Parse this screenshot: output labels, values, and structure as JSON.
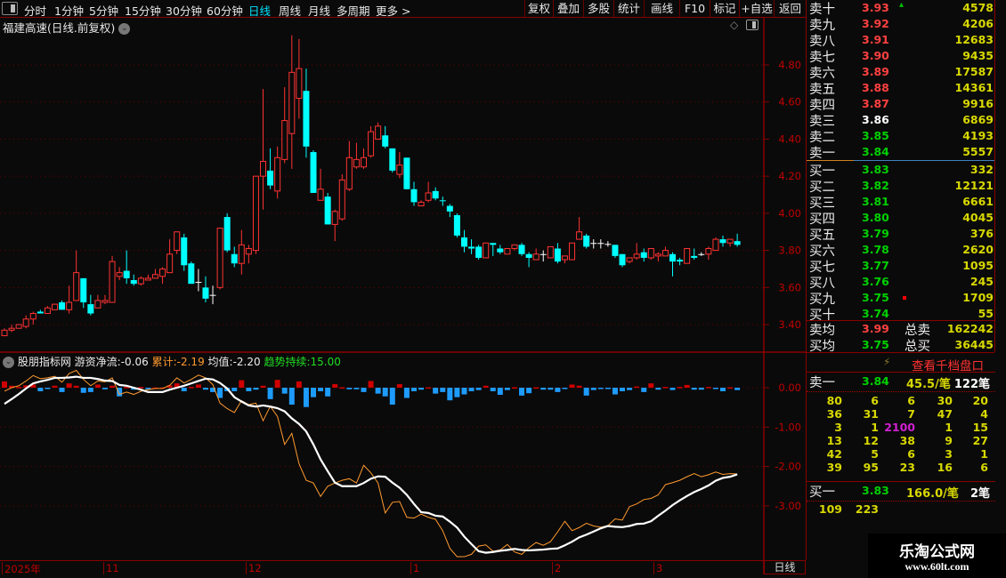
{
  "toolbar": {
    "tabs": [
      "分时",
      "1分钟",
      "5分钟",
      "15分钟",
      "30分钟",
      "60分钟",
      "日线",
      "周线",
      "月线",
      "多周期",
      "更多 >"
    ],
    "active_tab": "日线",
    "buttons": [
      "复权",
      "叠加",
      "多股",
      "统计",
      "画线",
      "F10",
      "标记",
      "+自选",
      "返回"
    ]
  },
  "stock": {
    "title": "福建高速(日线.前复权)"
  },
  "price_axis": [
    "4.80",
    "4.60",
    "4.40",
    "4.20",
    "4.00",
    "3.80",
    "3.60",
    "3.40"
  ],
  "indicator": {
    "name": "股朋指标网",
    "net_label": "游资净流:",
    "net_value": "-0.06",
    "cum_label": "累计:",
    "cum_value": "-2.19",
    "avg_label": "均值:",
    "avg_value": "-2.20",
    "trend_label": "趋势持续:",
    "trend_value": "15.00",
    "axis": [
      "0.00",
      "-1.00",
      "-2.00",
      "-3.00"
    ]
  },
  "date_axis": [
    "2025年",
    "11",
    "12",
    "1",
    "2",
    "3"
  ],
  "period": "日线",
  "colors": {
    "up": "#ff3232",
    "down": "#00ffff",
    "bg": "#0a0a0a",
    "grid": "#8b0000",
    "avg_line": "#ffffff",
    "cum_line": "#ff9a2e",
    "bar_up": "#d00000",
    "bar_down": "#1e9bff"
  },
  "order_book": {
    "asks": [
      {
        "label": "卖十",
        "price": "3.93",
        "vol": "4578",
        "mark": "up-triangle"
      },
      {
        "label": "卖九",
        "price": "3.92",
        "vol": "4206"
      },
      {
        "label": "卖八",
        "price": "3.91",
        "vol": "12683"
      },
      {
        "label": "卖七",
        "price": "3.90",
        "vol": "9435"
      },
      {
        "label": "卖六",
        "price": "3.89",
        "vol": "17587"
      },
      {
        "label": "卖五",
        "price": "3.88",
        "vol": "14361"
      },
      {
        "label": "卖四",
        "price": "3.87",
        "vol": "9916"
      },
      {
        "label": "卖三",
        "price": "3.86",
        "vol": "6869"
      },
      {
        "label": "卖二",
        "price": "3.85",
        "vol": "4193"
      },
      {
        "label": "卖一",
        "price": "3.84",
        "vol": "5557"
      }
    ],
    "bids": [
      {
        "label": "买一",
        "price": "3.83",
        "vol": "332"
      },
      {
        "label": "买二",
        "price": "3.82",
        "vol": "12121"
      },
      {
        "label": "买三",
        "price": "3.81",
        "vol": "6661"
      },
      {
        "label": "买四",
        "price": "3.80",
        "vol": "4045"
      },
      {
        "label": "买五",
        "price": "3.79",
        "vol": "376"
      },
      {
        "label": "买六",
        "price": "3.78",
        "vol": "2620"
      },
      {
        "label": "买七",
        "price": "3.77",
        "vol": "1095"
      },
      {
        "label": "买八",
        "price": "3.76",
        "vol": "245"
      },
      {
        "label": "买九",
        "price": "3.75",
        "vol": "1709",
        "mark": "red-square"
      },
      {
        "label": "买十",
        "price": "3.74",
        "vol": "55"
      }
    ],
    "avg_sell": {
      "label": "卖均",
      "price": "3.99",
      "total_label": "总卖",
      "total": "162242"
    },
    "avg_buy": {
      "label": "买均",
      "price": "3.75",
      "total_label": "总买",
      "total": "36445"
    }
  },
  "tick_panel": {
    "link": "查看千档盘口",
    "ask1": {
      "label": "卖一",
      "price": "3.84",
      "avg": "45.5/笔",
      "count": "122笔"
    },
    "ask_queue": [
      [
        "80",
        "6",
        "6",
        "30",
        "20"
      ],
      [
        "36",
        "31",
        "7",
        "47",
        "4"
      ],
      [
        "3",
        "1",
        "2100",
        "1",
        "15"
      ],
      [
        "13",
        "12",
        "38",
        "9",
        "27"
      ],
      [
        "42",
        "5",
        "6",
        "3",
        "1"
      ],
      [
        "39",
        "95",
        "23",
        "16",
        "6"
      ]
    ],
    "highlight": "2100",
    "bid1": {
      "label": "买一",
      "price": "3.83",
      "avg": "166.0/笔",
      "count": "2笔"
    },
    "bid_queue": [
      "109",
      "223"
    ]
  },
  "watermark": {
    "name": "乐淘公式网",
    "url": "www.60lt.com"
  },
  "chart_data": {
    "type": "candlestick",
    "ylim": [
      3.3,
      4.98
    ],
    "ohlc": [
      [
        3.34,
        3.38,
        3.34,
        3.37
      ],
      [
        3.37,
        3.4,
        3.36,
        3.38
      ],
      [
        3.38,
        3.4,
        3.38,
        3.4
      ],
      [
        3.39,
        3.45,
        3.38,
        3.43
      ],
      [
        3.43,
        3.47,
        3.4,
        3.46
      ],
      [
        3.47,
        3.48,
        3.46,
        3.46
      ],
      [
        3.46,
        3.5,
        3.46,
        3.49
      ],
      [
        3.48,
        3.51,
        3.48,
        3.51
      ],
      [
        3.52,
        3.53,
        3.48,
        3.48
      ],
      [
        3.48,
        3.61,
        3.46,
        3.52
      ],
      [
        3.53,
        3.8,
        3.53,
        3.68
      ],
      [
        3.65,
        3.65,
        3.49,
        3.52
      ],
      [
        3.51,
        3.56,
        3.45,
        3.46
      ],
      [
        3.49,
        3.56,
        3.49,
        3.53
      ],
      [
        3.52,
        3.56,
        3.51,
        3.53
      ],
      [
        3.52,
        3.77,
        3.52,
        3.74
      ],
      [
        3.66,
        3.71,
        3.64,
        3.68
      ],
      [
        3.69,
        3.8,
        3.62,
        3.65
      ],
      [
        3.64,
        3.67,
        3.61,
        3.62
      ],
      [
        3.62,
        3.66,
        3.61,
        3.65
      ],
      [
        3.64,
        3.67,
        3.64,
        3.65
      ],
      [
        3.65,
        3.7,
        3.65,
        3.67
      ],
      [
        3.66,
        3.71,
        3.62,
        3.7
      ],
      [
        3.68,
        3.86,
        3.68,
        3.78
      ],
      [
        3.8,
        3.9,
        3.78,
        3.9
      ],
      [
        3.87,
        3.89,
        3.69,
        3.72
      ],
      [
        3.73,
        3.74,
        3.62,
        3.62
      ],
      [
        3.63,
        3.7,
        3.58,
        3.63
      ],
      [
        3.6,
        3.66,
        3.52,
        3.54
      ],
      [
        3.56,
        3.61,
        3.51,
        3.56
      ],
      [
        3.6,
        3.92,
        3.59,
        3.92
      ],
      [
        3.98,
        4.0,
        3.79,
        3.8
      ],
      [
        3.78,
        3.82,
        3.71,
        3.73
      ],
      [
        3.73,
        3.91,
        3.67,
        3.83
      ],
      [
        3.78,
        3.83,
        3.73,
        3.81
      ],
      [
        3.8,
        4.2,
        3.78,
        4.2
      ],
      [
        4.2,
        4.67,
        4.02,
        4.28
      ],
      [
        4.23,
        4.35,
        4.13,
        4.15
      ],
      [
        4.12,
        4.36,
        4.08,
        4.3
      ],
      [
        4.29,
        4.68,
        4.27,
        4.5
      ],
      [
        4.43,
        4.96,
        4.24,
        4.76
      ],
      [
        4.62,
        4.94,
        4.51,
        4.78
      ],
      [
        4.66,
        4.78,
        4.3,
        4.36
      ],
      [
        4.33,
        4.34,
        4.11,
        4.11
      ],
      [
        4.07,
        4.24,
        4.07,
        4.13
      ],
      [
        4.09,
        4.11,
        3.94,
        3.94
      ],
      [
        3.94,
        4.02,
        3.85,
        4.01
      ],
      [
        3.97,
        4.21,
        3.96,
        4.18
      ],
      [
        4.13,
        4.39,
        4.12,
        4.3
      ],
      [
        4.25,
        4.38,
        4.24,
        4.29
      ],
      [
        4.25,
        4.35,
        4.24,
        4.3
      ],
      [
        4.31,
        4.47,
        4.3,
        4.44
      ],
      [
        4.4,
        4.49,
        4.4,
        4.47
      ],
      [
        4.42,
        4.47,
        4.35,
        4.36
      ],
      [
        4.35,
        4.35,
        4.22,
        4.23
      ],
      [
        4.21,
        4.33,
        4.19,
        4.26
      ],
      [
        4.3,
        4.3,
        4.13,
        4.13
      ],
      [
        4.13,
        4.17,
        4.04,
        4.06
      ],
      [
        4.04,
        4.07,
        4.04,
        4.06
      ],
      [
        4.07,
        4.17,
        4.06,
        4.11
      ],
      [
        4.12,
        4.14,
        4.07,
        4.08
      ],
      [
        4.07,
        4.09,
        4.04,
        4.065
      ],
      [
        4.04,
        4.05,
        3.98,
        4.01
      ],
      [
        3.99,
        4.0,
        3.87,
        3.88
      ],
      [
        3.87,
        3.91,
        3.79,
        3.82
      ],
      [
        3.82,
        3.86,
        3.78,
        3.81
      ],
      [
        3.82,
        3.83,
        3.75,
        3.76
      ],
      [
        3.76,
        3.84,
        3.76,
        3.84
      ],
      [
        3.84,
        3.84,
        3.77,
        3.83
      ],
      [
        3.81,
        3.83,
        3.78,
        3.79
      ],
      [
        3.78,
        3.81,
        3.78,
        3.81
      ],
      [
        3.81,
        3.83,
        3.8,
        3.83
      ],
      [
        3.83,
        3.84,
        3.77,
        3.78
      ],
      [
        3.78,
        3.79,
        3.71,
        3.76
      ],
      [
        3.75,
        3.81,
        3.75,
        3.78
      ],
      [
        3.78,
        3.8,
        3.74,
        3.78
      ],
      [
        3.76,
        3.82,
        3.76,
        3.82
      ],
      [
        3.81,
        3.84,
        3.73,
        3.74
      ],
      [
        3.75,
        3.77,
        3.73,
        3.77
      ],
      [
        3.75,
        3.84,
        3.75,
        3.84
      ],
      [
        3.86,
        3.98,
        3.86,
        3.9
      ],
      [
        3.88,
        3.89,
        3.81,
        3.82
      ],
      [
        3.84,
        3.86,
        3.81,
        3.84
      ],
      [
        3.84,
        3.86,
        3.81,
        3.84
      ],
      [
        3.835,
        3.85,
        3.82,
        3.835
      ],
      [
        3.83,
        3.83,
        3.76,
        3.77
      ],
      [
        3.78,
        3.78,
        3.71,
        3.72
      ],
      [
        3.74,
        3.76,
        3.73,
        3.76
      ],
      [
        3.76,
        3.84,
        3.75,
        3.78
      ],
      [
        3.79,
        3.81,
        3.74,
        3.76
      ],
      [
        3.76,
        3.81,
        3.75,
        3.81
      ],
      [
        3.77,
        3.79,
        3.74,
        3.78
      ],
      [
        3.77,
        3.82,
        3.77,
        3.8
      ],
      [
        3.78,
        3.79,
        3.66,
        3.74
      ],
      [
        3.75,
        3.76,
        3.72,
        3.74
      ],
      [
        3.73,
        3.81,
        3.73,
        3.81
      ],
      [
        3.77,
        3.81,
        3.75,
        3.76
      ],
      [
        3.78,
        3.79,
        3.77,
        3.78
      ],
      [
        3.78,
        3.82,
        3.75,
        3.81
      ],
      [
        3.8,
        3.87,
        3.8,
        3.86
      ],
      [
        3.86,
        3.88,
        3.82,
        3.84
      ],
      [
        3.84,
        3.86,
        3.82,
        3.86
      ],
      [
        3.85,
        3.89,
        3.82,
        3.83
      ]
    ],
    "indicator_ylim": [
      -4.4,
      0.9
    ],
    "net_flow": [
      0.16,
      0.05,
      0.02,
      0.06,
      0.08,
      -0.09,
      -0.02,
      0.05,
      -0.11,
      0.11,
      0.05,
      -0.13,
      -0.11,
      0.08,
      -0.04,
      0.05,
      -0.22,
      0.02,
      -0.05,
      0.02,
      -0.04,
      0.005,
      0.005,
      0.06,
      0.11,
      -0.09,
      0.02,
      0.08,
      -0.05,
      -0.11,
      -0.26,
      -0.09,
      -0.09,
      0.19,
      -0.09,
      -0.05,
      0.05,
      -0.29,
      0.2,
      -0.15,
      -0.43,
      0.16,
      -0.49,
      -0.24,
      -0.09,
      -0.22,
      0.09,
      0.01,
      -0.04,
      -0.04,
      -0.11,
      0.17,
      -0.15,
      -0.22,
      -0.43,
      0.09,
      -0.26,
      -0.09,
      -0.05,
      0.01,
      -0.15,
      -0.11,
      -0.32,
      -0.24,
      -0.17,
      -0.09,
      -0.06,
      0.05,
      -0.09,
      -0.18,
      -0.06,
      0.01,
      -0.2,
      -0.14,
      0.01,
      -0.05,
      -0.05,
      -0.11,
      -0.02,
      0.08,
      0.05,
      -0.2,
      -0.06,
      -0.03,
      -0.03,
      -0.17,
      -0.09,
      -0.06,
      0.03,
      -0.11,
      0.11,
      -0.05,
      0.02,
      -0.06,
      0.02,
      0.07,
      -0.05,
      -0.05,
      0.02,
      -0.03,
      -0.09,
      0.01,
      -0.06
    ],
    "cumulative": [
      -0.09,
      0,
      0.05,
      0.17,
      0.31,
      0.23,
      0.25,
      0.29,
      0.14,
      0.36,
      0.44,
      0.21,
      0.05,
      0.17,
      0.15,
      0.25,
      -0.17,
      -0.11,
      -0.17,
      -0.09,
      -0.05,
      -0.02,
      -0.02,
      0.06,
      0.25,
      0.12,
      0.21,
      0.32,
      0.25,
      0.08,
      -0.39,
      -0.53,
      -0.63,
      -0.33,
      -0.43,
      -0.39,
      -0.84,
      -0.47,
      -0.73,
      -1.44,
      -1.16,
      -1.93,
      -2.35,
      -2.42,
      -2.76,
      -2.5,
      -2.42,
      -2.35,
      -2.31,
      -2.42,
      -1.97,
      -2.16,
      -2.42,
      -3.18,
      -2.91,
      -2.89,
      -3.29,
      -3.31,
      -3.21,
      -3.29,
      -3.34,
      -3.63,
      -4.08,
      -4.29,
      -4.29,
      -4.23,
      -4.02,
      -3.99,
      -4.15,
      -4.12,
      -3.98,
      -4.17,
      -4.23,
      -4.06,
      -3.93,
      -4.0,
      -3.91,
      -3.66,
      -3.39,
      -3.63,
      -3.55,
      -3.44,
      -3.51,
      -3.54,
      -3.5,
      -3.33,
      -3.36,
      -3.02,
      -2.95,
      -2.84,
      -2.81,
      -2.72,
      -2.46,
      -2.41,
      -2.35,
      -2.26,
      -2.18,
      -2.26,
      -2.21,
      -2.14,
      -2.2,
      -2.18,
      -2.19
    ],
    "average": [
      -0.41,
      -0.29,
      -0.16,
      -0.02,
      0.11,
      0.16,
      0.2,
      0.25,
      0.25,
      0.26,
      0.28,
      0.25,
      0.25,
      0.22,
      0.18,
      0.17,
      0.07,
      0.05,
      0,
      -0.05,
      -0.11,
      -0.11,
      -0.11,
      -0.05,
      0,
      0.05,
      0.11,
      0.17,
      0.23,
      0.21,
      0.12,
      -0.02,
      -0.24,
      -0.35,
      -0.45,
      -0.48,
      -0.45,
      -0.48,
      -0.52,
      -0.6,
      -0.78,
      -0.92,
      -1.11,
      -1.44,
      -1.82,
      -2.12,
      -2.41,
      -2.5,
      -2.5,
      -2.5,
      -2.42,
      -2.31,
      -2.25,
      -2.26,
      -2.41,
      -2.54,
      -2.72,
      -2.95,
      -3.16,
      -3.18,
      -3.25,
      -3.27,
      -3.4,
      -3.55,
      -3.78,
      -3.97,
      -4.15,
      -4.19,
      -4.17,
      -4.14,
      -4.12,
      -4.09,
      -4.12,
      -4.13,
      -4.12,
      -4.11,
      -4.09,
      -4.08,
      -4.0,
      -3.91,
      -3.8,
      -3.73,
      -3.65,
      -3.57,
      -3.51,
      -3.53,
      -3.54,
      -3.51,
      -3.46,
      -3.45,
      -3.39,
      -3.25,
      -3.12,
      -2.98,
      -2.86,
      -2.75,
      -2.65,
      -2.57,
      -2.48,
      -2.36,
      -2.29,
      -2.26,
      -2.2
    ]
  }
}
